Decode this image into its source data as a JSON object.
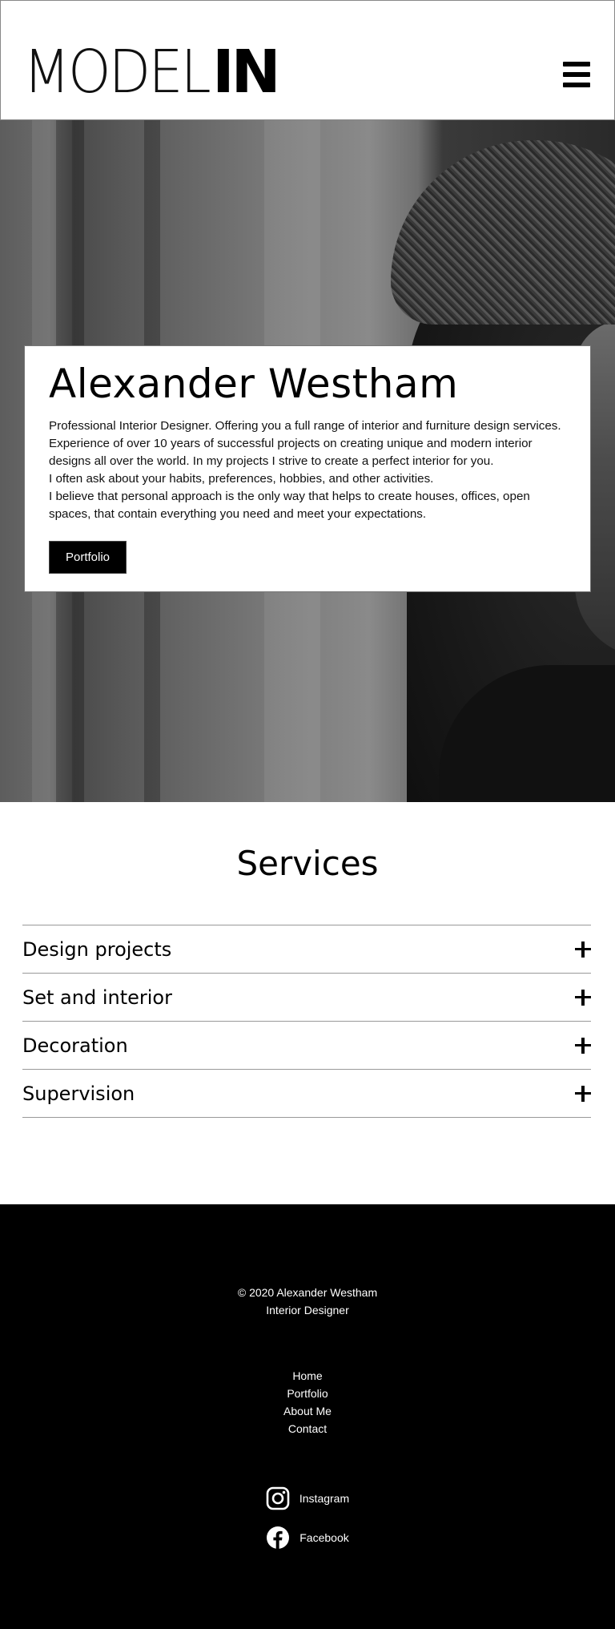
{
  "header": {
    "logo_thin": "MODEL",
    "logo_bold": "IN",
    "menu_icon": "hamburger-icon"
  },
  "hero": {
    "title": "Alexander Westham",
    "description": [
      "Professional Interior Designer. Offering you a full range of interior and furniture design services. Experience of over 10 years of successful projects on creating unique and modern interior designs all over the world. In my projects I strive to create a perfect interior for you.",
      "I often ask about your habits, preferences, hobbies, and other activities.",
      "I believe that personal approach is the only way that helps to create houses, offices, open spaces, that contain everything you need and meet your expectations."
    ],
    "button_label": "Portfolio"
  },
  "services": {
    "title": "Services",
    "items": [
      {
        "label": "Design projects",
        "icon": "plus-icon"
      },
      {
        "label": "Set and interior",
        "icon": "plus-icon"
      },
      {
        "label": "Decoration",
        "icon": "plus-icon"
      },
      {
        "label": "Supervision",
        "icon": "plus-icon"
      }
    ]
  },
  "footer": {
    "copyright": "© 2020 Alexander Westham",
    "role": "Interior Designer",
    "nav": [
      "Home",
      "Portfolio",
      "About Me",
      "Contact"
    ],
    "social": [
      {
        "label": "Instagram",
        "icon": "instagram-icon"
      },
      {
        "label": "Facebook",
        "icon": "facebook-icon"
      }
    ]
  },
  "colors": {
    "background": "#ffffff",
    "footer": "#000000",
    "button": "#000000",
    "divider": "#999999"
  }
}
